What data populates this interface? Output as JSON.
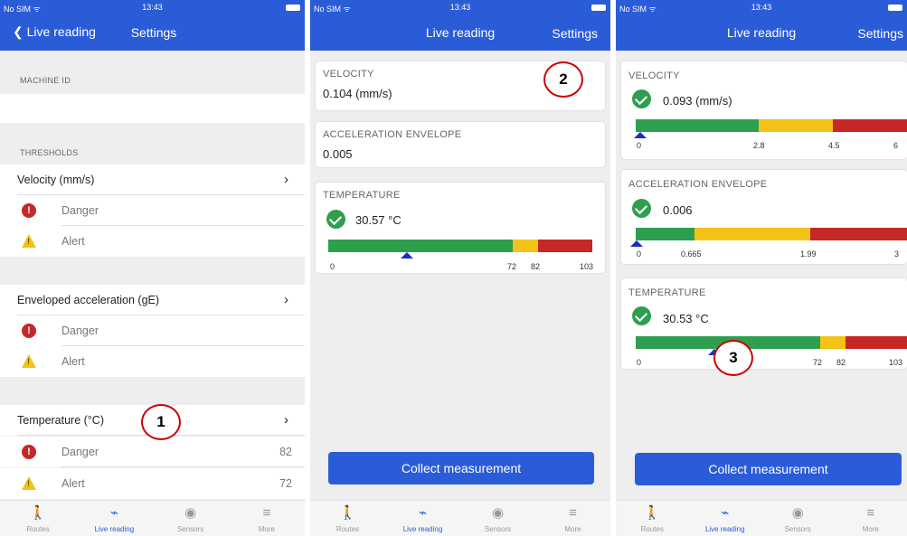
{
  "status": {
    "carrier": "No SIM ᯤ",
    "time": "13:43"
  },
  "colors": {
    "primary": "#2b5cd8",
    "ok": "#2e9e4f",
    "warn": "#f3c317",
    "danger": "#c62828",
    "callout": "#cc0000"
  },
  "tabs": [
    {
      "label": "Routes",
      "icon": "walking-person-icon"
    },
    {
      "label": "Live reading",
      "icon": "pulse-icon"
    },
    {
      "label": "Sensors",
      "icon": "sensor-icon"
    },
    {
      "label": "More",
      "icon": "menu-icon"
    }
  ],
  "screen1": {
    "back_label": "❮ Live reading",
    "title": "Settings",
    "machine_id_header": "MACHINE ID",
    "thresholds_header": "THRESHOLDS",
    "groups": [
      {
        "title": "Velocity (mm/s)",
        "danger_label": "Danger",
        "danger_value": "",
        "alert_label": "Alert",
        "alert_value": ""
      },
      {
        "title": "Enveloped acceleration (gE)",
        "danger_label": "Danger",
        "danger_value": "",
        "alert_label": "Alert",
        "alert_value": ""
      },
      {
        "title": "Temperature (°C)",
        "danger_label": "Danger",
        "danger_value": "82",
        "alert_label": "Alert",
        "alert_value": "72"
      }
    ],
    "callout": "1"
  },
  "screen2": {
    "title": "Live reading",
    "settings_label": "Settings",
    "velocity": {
      "label": "VELOCITY",
      "value": "0.104 (mm/s)"
    },
    "acceleration": {
      "label": "ACCELERATION ENVELOPE",
      "value": "0.005"
    },
    "temperature": {
      "label": "TEMPERATURE",
      "value": "30.57 °C",
      "ticks": [
        "0",
        "72",
        "82",
        "103"
      ],
      "scale_max": 103,
      "reading": 30.57
    },
    "collect_label": "Collect measurement",
    "callout": "2"
  },
  "screen3": {
    "title": "Live reading",
    "settings_label": "Settings",
    "velocity": {
      "label": "VELOCITY",
      "value": "0.093 (mm/s)",
      "ticks": [
        "0",
        "2.8",
        "4.5",
        "6"
      ],
      "reading": 0.093
    },
    "acceleration": {
      "label": "ACCELERATION ENVELOPE",
      "value": "0.006",
      "ticks": [
        "0",
        "0.665",
        "1.99",
        "3"
      ],
      "reading": 0.006
    },
    "temperature": {
      "label": "TEMPERATURE",
      "value": "30.53 °C",
      "ticks": [
        "0",
        "72",
        "82",
        "103"
      ],
      "reading": 30.53
    },
    "collect_label": "Collect measurement",
    "callout": "3"
  }
}
